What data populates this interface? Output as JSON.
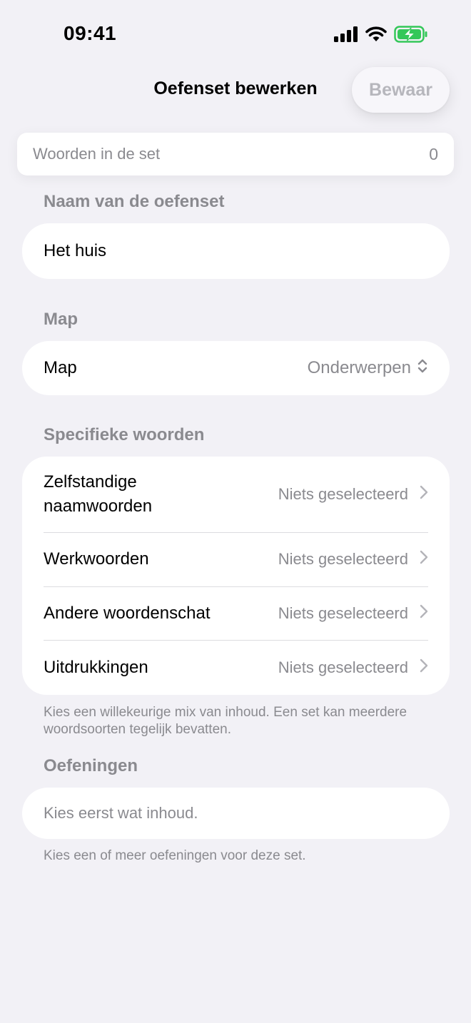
{
  "status": {
    "time": "09:41"
  },
  "nav": {
    "title": "Oefenset bewerken",
    "save_label": "Bewaar"
  },
  "count": {
    "label": "Woorden in de set",
    "value": "0"
  },
  "name_section": {
    "header": "Naam van de oefenset",
    "value": "Het huis"
  },
  "map_section": {
    "header": "Map",
    "row_label": "Map",
    "selected": "Onderwerpen"
  },
  "specific_section": {
    "header": "Specifieke woorden",
    "items": [
      {
        "label": "Zelfstandige naamwoorden",
        "value": "Niets geselecteerd"
      },
      {
        "label": "Werkwoorden",
        "value": "Niets geselecteerd"
      },
      {
        "label": "Andere woordenschat",
        "value": "Niets geselecteerd"
      },
      {
        "label": "Uitdrukkingen",
        "value": "Niets geselecteerd"
      }
    ],
    "footnote": "Kies een willekeurige mix van inhoud. Een set kan meerdere woordsoorten tegelijk bevatten."
  },
  "exercises_section": {
    "header": "Oefeningen",
    "placeholder": "Kies eerst wat inhoud.",
    "footnote": "Kies een of meer oefeningen voor deze set."
  },
  "icons": {
    "signal": "cellular-signal-icon",
    "wifi": "wifi-icon",
    "battery": "battery-charging-icon",
    "chevron_right": "chevron-right-icon",
    "updown": "chevron-up-down-icon"
  },
  "colors": {
    "background": "#f2f1f6",
    "secondary_text": "#8a8a8f",
    "battery": "#34c759"
  }
}
